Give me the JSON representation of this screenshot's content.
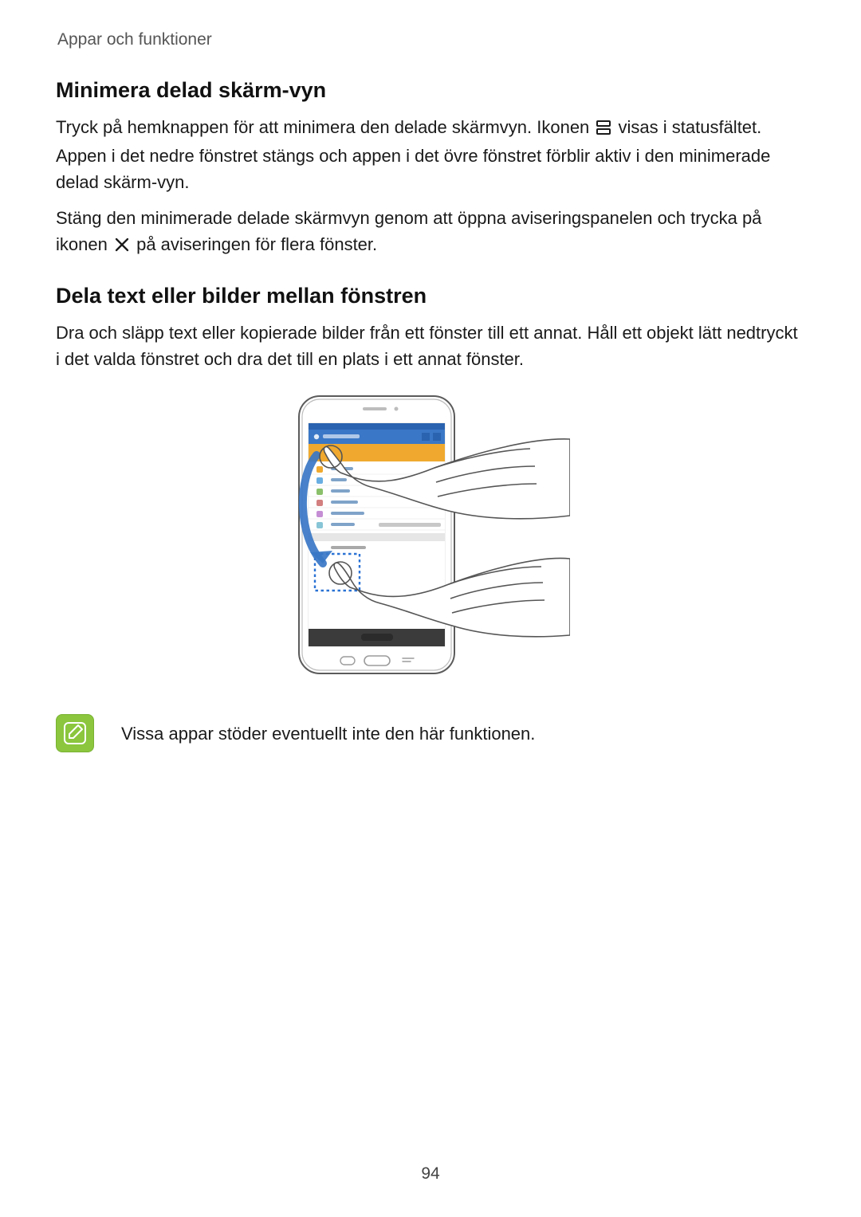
{
  "breadcrumb": "Appar och funktioner",
  "section1": {
    "title": "Minimera delad skärm-vyn",
    "para1_a": "Tryck på hemknappen för att minimera den delade skärmvyn. Ikonen ",
    "para1_b": " visas i statusfältet. Appen i det nedre fönstret stängs och appen i det övre fönstret förblir aktiv i den minimerade delad skärm-vyn.",
    "para2_a": "Stäng den minimerade delade skärmvyn genom att öppna aviseringspanelen och trycka på ikonen ",
    "para2_b": " på aviseringen för flera fönster."
  },
  "section2": {
    "title": "Dela text eller bilder mellan fönstren",
    "para1": "Dra och släpp text eller kopierade bilder från ett fönster till ett annat. Håll ett objekt lätt nedtryckt i det valda fönstret och dra det till en plats i ett annat fönster."
  },
  "note": {
    "text": "Vissa appar stöder eventuellt inte den här funktionen."
  },
  "page_number": "94",
  "icons": {
    "split_screen": "split-screen-icon",
    "close": "close-icon",
    "note": "note-pencil-icon"
  },
  "illustration_label": "drag-between-windows-illustration"
}
